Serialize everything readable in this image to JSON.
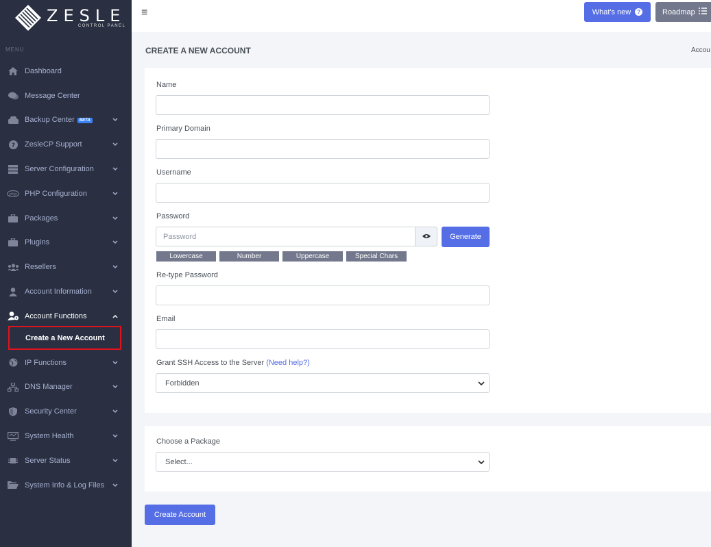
{
  "brand": {
    "name": "ZESLE",
    "tagline": "CONTROL PANEL"
  },
  "sidebar": {
    "menu_title": "MENU",
    "items": [
      {
        "label": "Dashboard",
        "icon": "home-icon",
        "chevron": false
      },
      {
        "label": "Message Center",
        "icon": "chat-icon",
        "chevron": false
      },
      {
        "label": "Backup Center",
        "icon": "hdd-icon",
        "chevron": true,
        "badge": "BETA"
      },
      {
        "label": "ZesleCP Support",
        "icon": "question-circle-icon",
        "chevron": true
      },
      {
        "label": "Server Configuration",
        "icon": "server-icon",
        "chevron": true
      },
      {
        "label": "PHP Configuration",
        "icon": "php-icon",
        "chevron": true
      },
      {
        "label": "Packages",
        "icon": "briefcase-icon",
        "chevron": true
      },
      {
        "label": "Plugins",
        "icon": "briefcase-icon",
        "chevron": true
      },
      {
        "label": "Resellers",
        "icon": "users-icon",
        "chevron": true
      },
      {
        "label": "Account Information",
        "icon": "user-icon",
        "chevron": true
      },
      {
        "label": "Account Functions",
        "icon": "user-cog-icon",
        "chevron": true,
        "expanded": true
      },
      {
        "label": "IP Functions",
        "icon": "globe-icon",
        "chevron": true
      },
      {
        "label": "DNS Manager",
        "icon": "sitemap-icon",
        "chevron": true
      },
      {
        "label": "Security Center",
        "icon": "shield-icon",
        "chevron": true
      },
      {
        "label": "System Health",
        "icon": "monitor-icon",
        "chevron": true
      },
      {
        "label": "Server Status",
        "icon": "chip-icon",
        "chevron": true
      },
      {
        "label": "System Info & Log Files",
        "icon": "folder-open-icon",
        "chevron": true
      }
    ],
    "active_sub_item": "Create a New Account"
  },
  "topbar": {
    "whats_new": "What's new",
    "roadmap": "Roadmap"
  },
  "page": {
    "title": "CREATE A NEW ACCOUNT",
    "breadcrumb": "Accou"
  },
  "form": {
    "name_label": "Name",
    "name_value": "",
    "domain_label": "Primary Domain",
    "domain_value": "",
    "username_label": "Username",
    "username_value": "",
    "password_label": "Password",
    "password_placeholder": "Password",
    "generate_label": "Generate",
    "chips": [
      "Lowercase",
      "Number",
      "Uppercase",
      "Special Chars"
    ],
    "retype_label": "Re-type Password",
    "email_label": "Email",
    "ssh_label": "Grant SSH Access to the Server",
    "ssh_help": "(Need help?)",
    "ssh_value": "Forbidden",
    "package_label": "Choose a Package",
    "package_value": "Select...",
    "submit_label": "Create Account"
  },
  "colors": {
    "primary": "#556ee6",
    "secondary": "#74788d",
    "sidebar": "#2a3042",
    "highlight": "#e0131d"
  }
}
